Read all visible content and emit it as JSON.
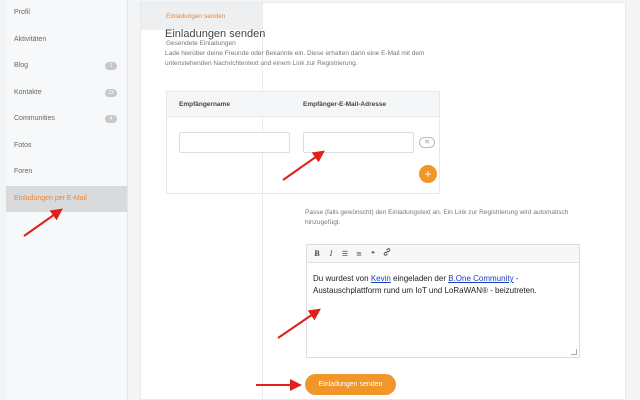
{
  "sidebar": {
    "items": [
      {
        "label": "Profil",
        "badge": ""
      },
      {
        "label": "Aktivitäten",
        "badge": ""
      },
      {
        "label": "Blog",
        "badge": "1"
      },
      {
        "label": "Kontakte",
        "badge": "13"
      },
      {
        "label": "Communities",
        "badge": "4"
      },
      {
        "label": "Fotos",
        "badge": ""
      },
      {
        "label": "Foren",
        "badge": ""
      },
      {
        "label": "Einladungen per E-Mail",
        "badge": ""
      }
    ],
    "active_index": 7
  },
  "subnav": {
    "items": [
      "Einladungen senden",
      "Gesendete Einladungen"
    ],
    "active_index": 0
  },
  "main": {
    "title": "Einladungen senden",
    "description": "Lade hierüber deine Freunde oder Bekannte ein. Diese erhalten dann eine E-Mail mit dem untenstehenden Nachrichtentext und einem Link zur Registrierung.",
    "table": {
      "col_name": "Empfängername",
      "col_email": "Empfänger-E-Mail-Adresse",
      "name_value": "",
      "email_value": "",
      "remove_symbol": "✕",
      "add_symbol": "+"
    },
    "message_label": "Passe (falls gewünscht) den Einladungstext an. Ein Link zur Registrierung wird automatisch hinzugefügt.",
    "toolbar": {
      "bold": "B",
      "italic": "I",
      "bullet_list": "☰",
      "numbered_list": "≡",
      "quote": "❝",
      "link": "🔗"
    },
    "message": {
      "part1": "Du wurdest von ",
      "user_link": "Kevin",
      "part2": " eingeladen der ",
      "community_link": "B.One Community",
      "part3": " - Austauschplattform rund um IoT und LoRaWAN® - beizutreten."
    },
    "send_button": "Einladungen senden"
  },
  "colors": {
    "accent": "#f0962a",
    "active_text": "#e8883a",
    "arrow": "#e0201b"
  }
}
